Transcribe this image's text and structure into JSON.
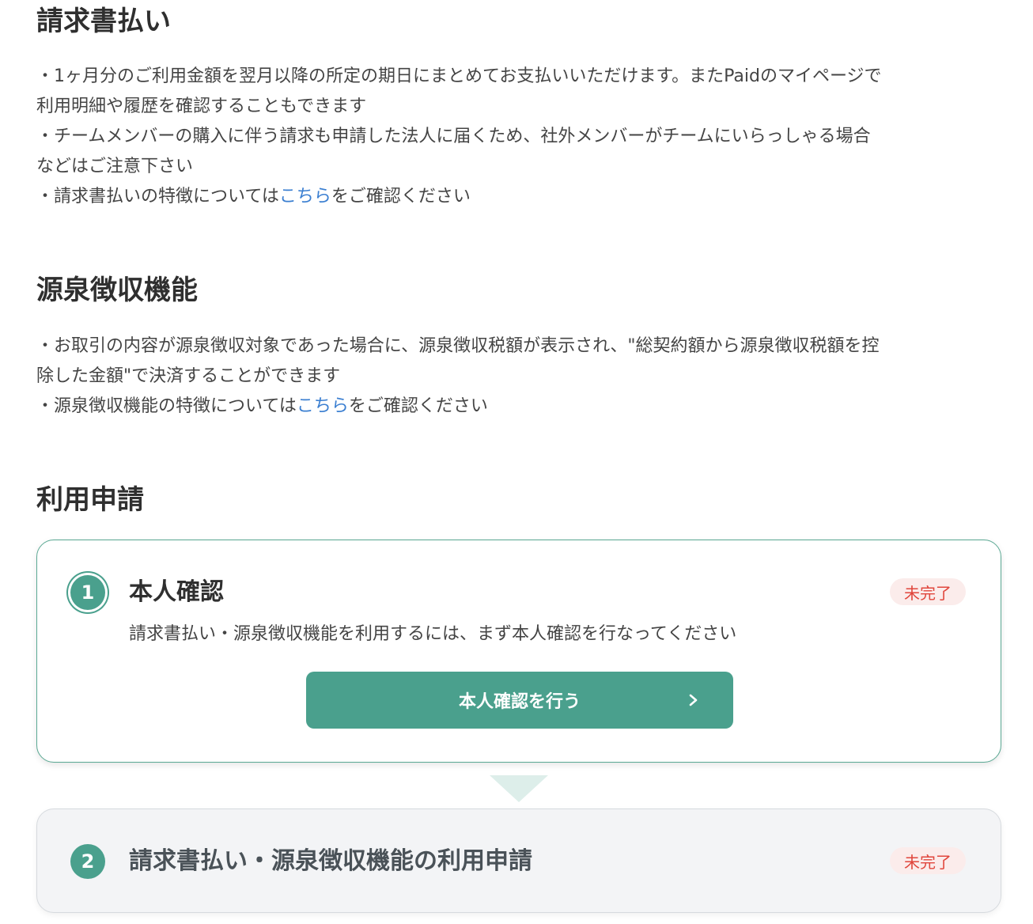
{
  "invoice_section": {
    "title": "請求書払い",
    "lines": [
      "・1ヶ月分のご利用金額を翌月以降の所定の期日にまとめてお支払いいただけます。またPaidのマイページで",
      "利用明細や履歴を確認することもできます",
      "・チームメンバーの購入に伴う請求も申請した法人に届くため、社外メンバーがチームにいらっしゃる場合",
      "などはご注意下さい"
    ],
    "feature_prefix": "・請求書払いの特徴については",
    "feature_link": "こちら",
    "feature_suffix": "をご確認ください"
  },
  "withholding_section": {
    "title": "源泉徴収機能",
    "lines": [
      "・お取引の内容が源泉徴収対象であった場合に、源泉徴収税額が表示され、\"総契約額から源泉徴収税額を控",
      "除した金額\"で決済することができます"
    ],
    "feature_prefix": "・源泉徴収機能の特徴については",
    "feature_link": "こちら",
    "feature_suffix": "をご確認ください"
  },
  "application_section": {
    "title": "利用申請",
    "steps": [
      {
        "number": "1",
        "title": "本人確認",
        "status": "未完了",
        "description": "請求書払い・源泉徴収機能を利用するには、まず本人確認を行なってください",
        "button_label": "本人確認を行う"
      },
      {
        "number": "2",
        "title": "請求書払い・源泉徴収機能の利用申請",
        "status": "未完了"
      }
    ]
  },
  "colors": {
    "accent": "#4aa08d",
    "link": "#3b7fd1",
    "status_text": "#e0463c",
    "status_bg": "#fbeceb"
  },
  "icons": {
    "button_chevron": "chevron-right-icon"
  }
}
